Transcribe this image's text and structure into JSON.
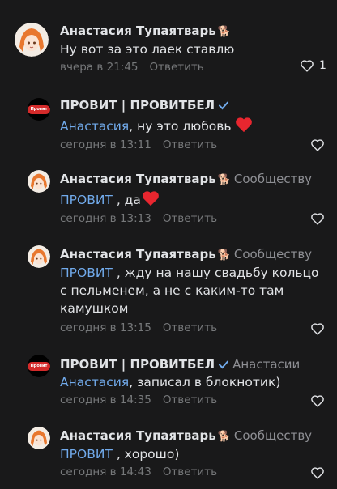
{
  "colors": {
    "background": "#19191a",
    "mention": "#71aaeb",
    "meta": "#76787a",
    "heart": "#e8262f"
  },
  "comments": [
    {
      "author": "Анастасия Тупаятварь",
      "pet": "🐕",
      "to": "",
      "mention": "",
      "text": "Ну вот за это лаек ставлю",
      "time": "вчера в 21:45",
      "reply": "Ответить",
      "likes": "1"
    },
    {
      "author": "ПРОВИТ | ПРОВИТБЕЛ",
      "to": "",
      "mention": "Анастасия",
      "text": ", ну это любовь",
      "time": "сегодня в 13:11",
      "reply": "Ответить"
    },
    {
      "author": "Анастасия Тупаятварь",
      "pet": "🐕",
      "to": "Сообществу",
      "mention": "ПРОВИТ",
      "text": " , да",
      "time": "сегодня в 13:13",
      "reply": "Ответить"
    },
    {
      "author": "Анастасия Тупаятварь",
      "pet": "🐕",
      "to": "Сообществу",
      "mention": "ПРОВИТ",
      "text": " , жду на нашу свадьбу кольцо с пельменем, а не с каким-то там камушком",
      "time": "сегодня в 13:15",
      "reply": "Ответить"
    },
    {
      "author": "ПРОВИТ | ПРОВИТБЕЛ",
      "to": "Анастасии",
      "mention": "Анастасия",
      "text": ", записал в блокнотик)",
      "time": "сегодня в 14:35",
      "reply": "Ответить"
    },
    {
      "author": "Анастасия Тупаятварь",
      "pet": "🐕",
      "to": "Сообществу",
      "mention": "ПРОВИТ",
      "text": " , хорошо)",
      "time": "сегодня в 14:43",
      "reply": "Ответить"
    }
  ],
  "logo_text": "Провит"
}
